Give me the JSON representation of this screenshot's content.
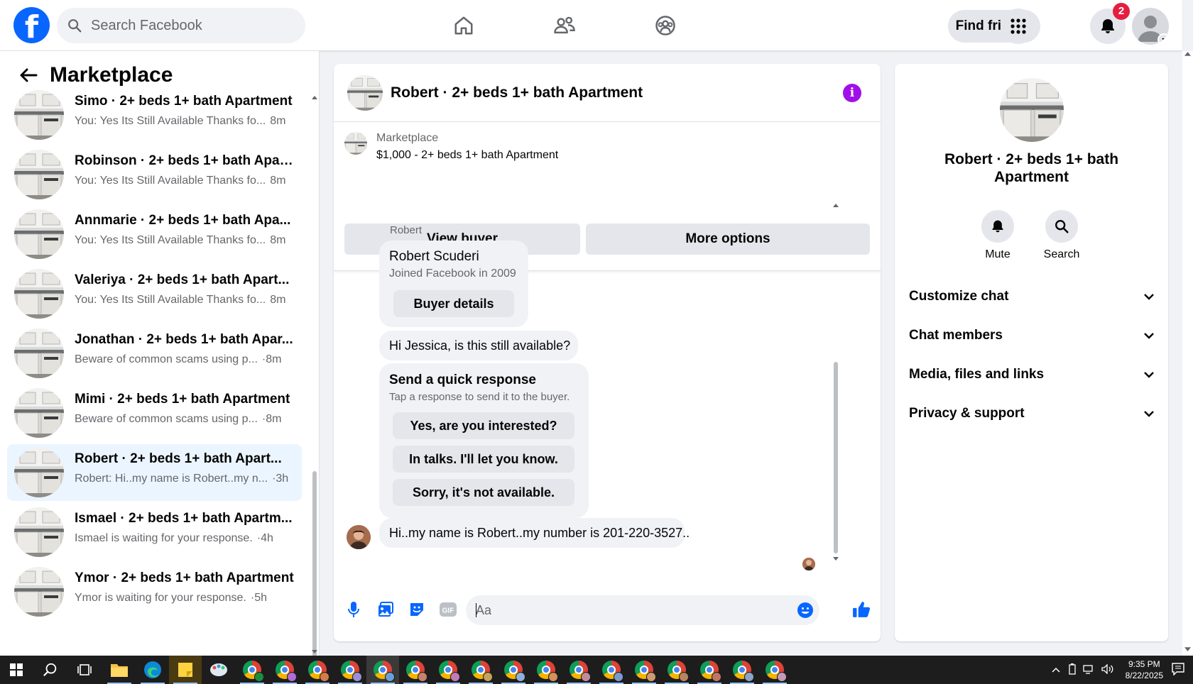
{
  "topbar": {
    "logo_letter": "f",
    "search_placeholder": "Search Facebook",
    "find_friends_label": "Find friends",
    "notification_count": "2",
    "nav_icons": [
      "home-icon",
      "friends-icon",
      "groups-icon"
    ]
  },
  "left": {
    "title": "Marketplace",
    "conversations": [
      {
        "title": "Simo · 2+ beds 1+ bath Apartment",
        "preview": "You: Yes Its Still Available Thanks fo...",
        "time": "8m",
        "active": false
      },
      {
        "title": "Robinson · 2+ beds 1+ bath Apar...",
        "preview": "You: Yes Its Still Available Thanks fo...",
        "time": "8m",
        "active": false
      },
      {
        "title": "Annmarie · 2+ beds 1+ bath Apa...",
        "preview": "You: Yes Its Still Available Thanks fo...",
        "time": "8m",
        "active": false
      },
      {
        "title": "Valeriya · 2+ beds 1+ bath Apart...",
        "preview": "You: Yes Its Still Available Thanks fo...",
        "time": "8m",
        "active": false
      },
      {
        "title": "Jonathan · 2+ beds 1+ bath Apar...",
        "preview": "Beware of common scams using p...",
        "time": "·8m",
        "active": false
      },
      {
        "title": "Mimi · 2+ beds 1+ bath Apartment",
        "preview": "Beware of common scams using p...",
        "time": "·8m",
        "active": false
      },
      {
        "title": "Robert · 2+ beds 1+ bath Apart...",
        "preview": "Robert: Hi..my name is Robert..my n...",
        "time": "·3h",
        "active": true
      },
      {
        "title": "Ismael · 2+ beds 1+ bath Apartm...",
        "preview": "Ismael is waiting for your response.",
        "time": "·4h",
        "active": false
      },
      {
        "title": "Ymor · 2+ beds 1+ bath Apartment",
        "preview": "Ymor is waiting for your response.",
        "time": "·5h",
        "active": false
      }
    ]
  },
  "chat": {
    "title": "Robert · 2+ beds 1+ bath Apartment",
    "listing_label": "Marketplace",
    "listing_price": "$1,000 - 2+ beds 1+ bath Apartment",
    "view_buyer_label": "View buyer",
    "more_options_label": "More options",
    "sender_name": "Robert",
    "buyer_card": {
      "name": "Robert Scuderi",
      "joined": "Joined Facebook in 2009",
      "button": "Buyer details"
    },
    "message_1": "Hi Jessica, is this still available?",
    "quick_response": {
      "title": "Send a quick response",
      "subtitle": "Tap a response to send it to the buyer.",
      "options": [
        "Yes, are you interested?",
        "In talks. I'll let you know.",
        "Sorry, it's not available."
      ]
    },
    "message_2": "Hi..my name is Robert..my number is 201-220-3527..",
    "composer_placeholder": "Aa",
    "composer_icons": [
      "microphone-icon",
      "photo-icon",
      "sticker-icon",
      "gif-icon",
      "emoji-icon",
      "thumbs-up-icon"
    ],
    "gif_text": "GIF"
  },
  "info": {
    "title": "Robert · 2+ beds 1+ bath Apartment",
    "actions": [
      {
        "label": "Mute",
        "icon": "bell-icon"
      },
      {
        "label": "Search",
        "icon": "search-icon"
      }
    ],
    "sections": [
      "Customize chat",
      "Chat members",
      "Media, files and links",
      "Privacy & support"
    ]
  },
  "taskbar": {
    "time": "9:35 PM",
    "date": "8/22/2025"
  },
  "colors": {
    "brand_blue": "#0866ff",
    "messenger_purple": "#a10fe8",
    "badge_red": "#e41e3f",
    "active_row": "#ebf5ff"
  }
}
